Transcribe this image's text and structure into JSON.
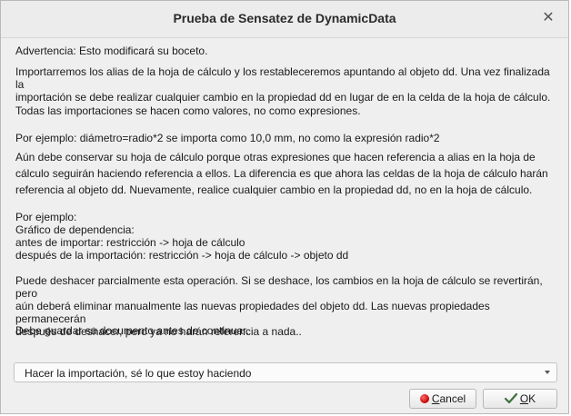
{
  "dialog": {
    "title": "Prueba de Sensatez de DynamicData",
    "close_icon": "close-icon"
  },
  "content": {
    "warning": "Advertencia: Esto modificará su boceto.",
    "import_info": "Importarremos los alias de la hoja de cálculo y los restableceremos apuntando al objeto dd. Una vez finalizada la\nimportación se debe realizar cualquier cambio en la propiedad dd en lugar de en la celda de la hoja de cálculo.",
    "values_info": "Todas las importaciones se hacen como valores, no como expresiones.",
    "example1": "Por ejemplo: diámetro=radio*2 se importa como 10,0 mm, no como la expresión radio*2",
    "keep_info": "Aún debe conservar su hoja de cálculo porque otras expresiones que hacen referencia a alias en la hoja de\ncálculo seguirán haciendo referencia a ellos. La diferencia es que ahora las celdas de la hoja de cálculo harán\nreferencia al objeto dd. Nuevamente, realice cualquier cambio en la propiedad dd, no en la hoja de cálculo.",
    "example2": "Por ejemplo:\nGráfico de dependencia:\nantes de importar: restricción -> hoja de cálculo\ndespués de la importación: restricción -> hoja de cálculo -> objeto dd",
    "undo_info": "Puede deshacer parcialmente esta operación. Si se deshace, los cambios en la hoja de cálculo se revertirán, pero\naún deberá eliminar manualmente las nuevas propiedades del objeto dd. Las nuevas propiedades permanecerán\ndespués de deshacer, pero ya no harán referencia a nada..",
    "save_info": "Debe guardar su documento antes de continuar."
  },
  "choice": {
    "selected": "Hacer la importación, sé lo que estoy haciendo"
  },
  "buttons": {
    "cancel_first": "C",
    "cancel_rest": "ancel",
    "ok_first": "O",
    "ok_rest": "K",
    "cancel_icon": "stop-icon",
    "ok_icon": "check-icon"
  }
}
